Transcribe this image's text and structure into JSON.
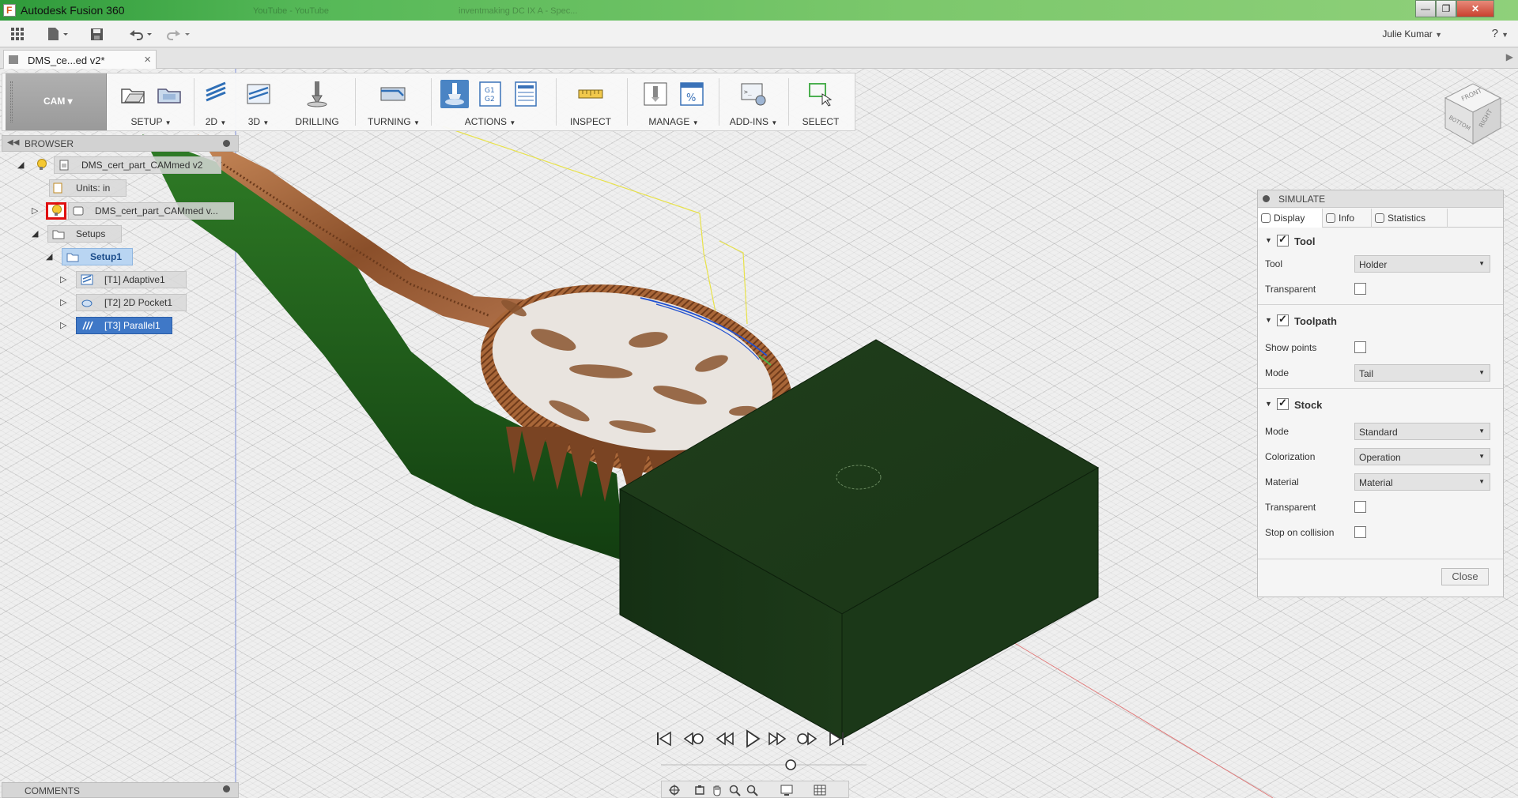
{
  "window": {
    "title": "Autodesk Fusion 360",
    "ghost_tabs": [
      "YouTube - YouTube",
      "inventmaking DC IX A - Spec..."
    ],
    "controls": [
      "minimize",
      "maximize",
      "close"
    ]
  },
  "quick_access": {
    "user": "Julie Kumar",
    "help": "?"
  },
  "document_tab": {
    "name": "DMS_ce...ed v2*",
    "close": "×"
  },
  "ribbon": {
    "workspace": "CAM",
    "groups": [
      {
        "label": "SETUP",
        "dropdown": true
      },
      {
        "label": "2D",
        "dropdown": true
      },
      {
        "label": "3D",
        "dropdown": true
      },
      {
        "label": "DRILLING",
        "dropdown": false
      },
      {
        "label": "TURNING",
        "dropdown": true
      },
      {
        "label": "ACTIONS",
        "dropdown": true
      },
      {
        "label": "INSPECT",
        "dropdown": false
      },
      {
        "label": "MANAGE",
        "dropdown": true
      },
      {
        "label": "ADD-INS",
        "dropdown": true
      },
      {
        "label": "SELECT",
        "dropdown": false
      }
    ],
    "actions_gcode_icon": {
      "line1": "G1",
      "line2": "G2"
    },
    "manage_percent_icon": "%"
  },
  "browser": {
    "title": "BROWSER",
    "tree": {
      "root": "DMS_cert_part_CAMmed v2",
      "units": "Units: in",
      "component": "DMS_cert_part_CAMmed v...",
      "setups": "Setups",
      "setup1": "Setup1",
      "op1": "[T1] Adaptive1",
      "op2": "[T2] 2D Pocket1",
      "op3": "[T3] Parallel1"
    }
  },
  "simulate": {
    "title": "SIMULATE",
    "tabs": {
      "display": "Display",
      "info": "Info",
      "statistics": "Statistics"
    },
    "tool": {
      "section": "Tool",
      "enabled": true,
      "tool_label": "Tool",
      "tool_value": "Holder",
      "transparent_label": "Transparent",
      "transparent": false
    },
    "toolpath": {
      "section": "Toolpath",
      "enabled": true,
      "show_points_label": "Show points",
      "show_points": false,
      "mode_label": "Mode",
      "mode_value": "Tail"
    },
    "stock": {
      "section": "Stock",
      "enabled": true,
      "mode_label": "Mode",
      "mode_value": "Standard",
      "colorization_label": "Colorization",
      "colorization_value": "Operation",
      "material_label": "Material",
      "material_value": "Material",
      "transparent_label": "Transparent",
      "transparent": false,
      "stop_label": "Stop on collision",
      "stop_on_collision": false
    },
    "close": "Close"
  },
  "viewcube": {
    "front": "FRONT",
    "right": "RIGHT",
    "bottom": "BOTTOM"
  },
  "playback": {
    "buttons": [
      "skip-to-start",
      "previous-operation",
      "step-back",
      "play",
      "step-forward",
      "next-operation",
      "skip-to-end"
    ],
    "position": 0.64
  },
  "comments": {
    "title": "COMMENTS"
  },
  "colors": {
    "stock_green": "#1f3a1a",
    "toolpath_blue": "#2050d0",
    "toolpath_yellow": "#e8e24a",
    "titlebar_green": "#55b857",
    "selection_blue": "#3f78c7",
    "highlight_red": "#e01010"
  }
}
